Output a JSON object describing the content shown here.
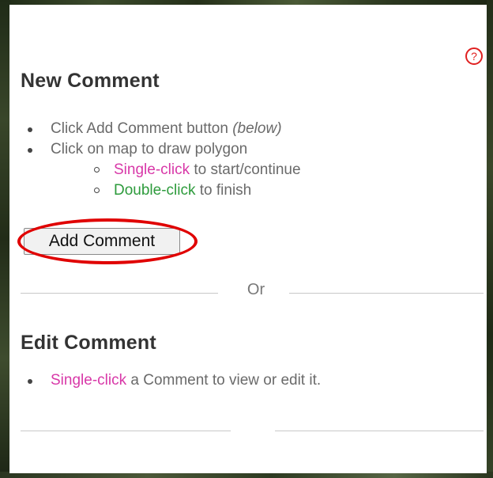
{
  "help": {
    "glyph": "?"
  },
  "new_comment": {
    "title": "New Comment",
    "step1": {
      "text": "Click Add Comment button ",
      "note": "(below)"
    },
    "step2": {
      "text": "Click on map to draw polygon"
    },
    "sub1": {
      "action": "Single-click",
      "rest": " to start/continue"
    },
    "sub2": {
      "action": "Double-click",
      "rest": " to finish"
    },
    "button_label": "Add Comment"
  },
  "separator": {
    "label": "Or"
  },
  "edit_comment": {
    "title": "Edit Comment",
    "step1": {
      "action": "Single-click",
      "rest": " a Comment to view or edit it."
    }
  },
  "colors": {
    "action_pink": "#d838a8",
    "action_green": "#2d9b3c",
    "highlight_red": "#e00000",
    "help_red": "#e02020"
  }
}
